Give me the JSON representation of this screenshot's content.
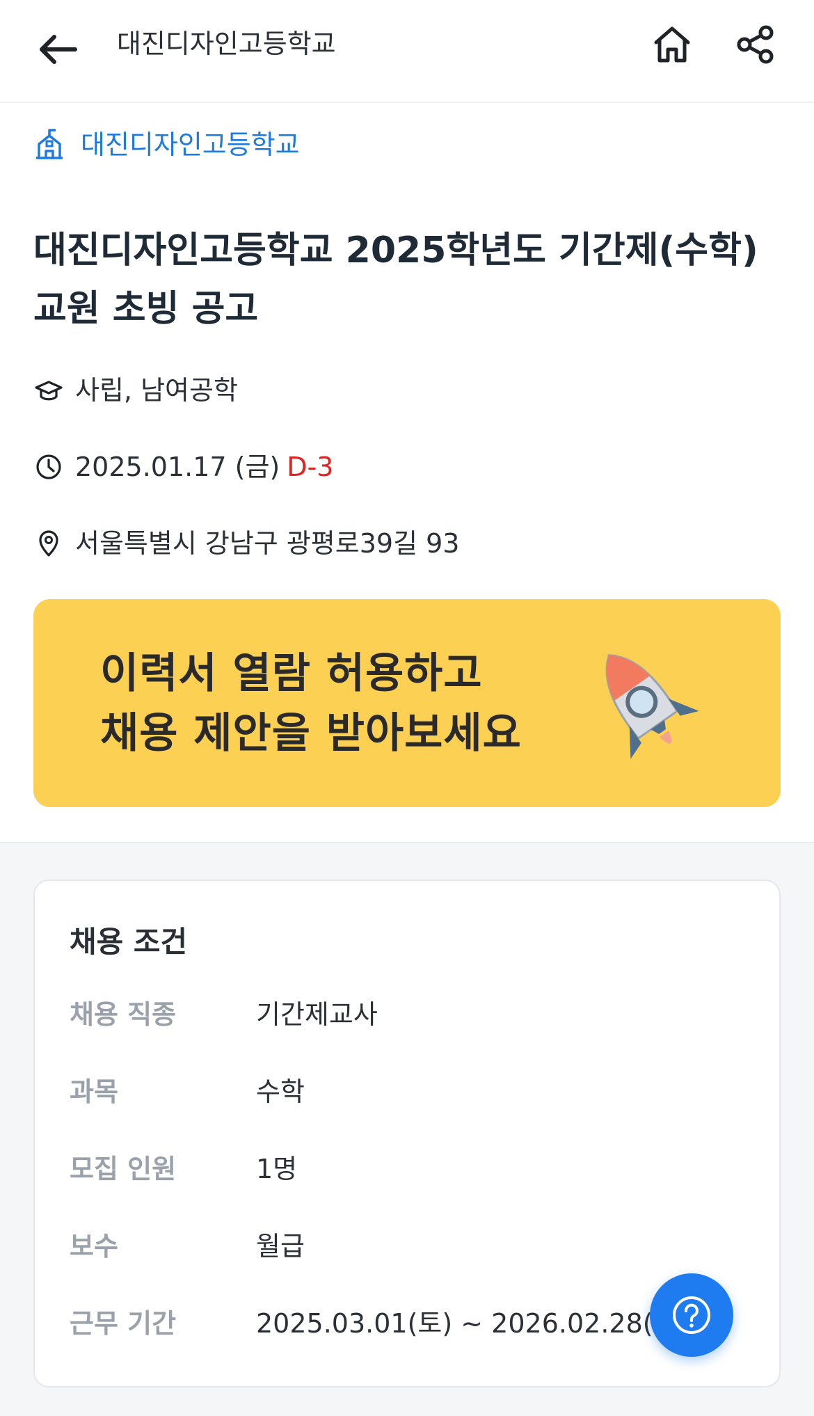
{
  "header": {
    "title": "대진디자인고등학교",
    "icons": {
      "back": "arrow-left-icon",
      "home": "home-icon",
      "share": "share-icon"
    }
  },
  "school_link": {
    "label": "대진디자인고등학교",
    "icon": "school-building-icon",
    "color": "#1f7ae0"
  },
  "job": {
    "title": "대진디자인고등학교 2025학년도 기간제(수학) 교원 초빙 공고",
    "school_type": "사립, 남여공학",
    "deadline": "2025.01.17 (금)",
    "dday": "D-3",
    "address": "서울특별시 강남구 광평로39길 93"
  },
  "banner": {
    "line1": "이력서 열람 허용하고",
    "line2": "채용 제안을 받아보세요",
    "icon": "rocket-icon",
    "color": "#fcd053"
  },
  "conditions": {
    "title": "채용 조건",
    "rows": [
      {
        "key": "채용 직종",
        "value": "기간제교사"
      },
      {
        "key": "과목",
        "value": "수학"
      },
      {
        "key": "모집 인원",
        "value": "1명"
      },
      {
        "key": "보수",
        "value": "월급"
      },
      {
        "key": "근무 기간",
        "value": "2025.03.01(토) ~ 2026.02.28(토)"
      }
    ]
  },
  "fab": {
    "icon": "help-question-icon",
    "color": "#1f7bf0"
  }
}
